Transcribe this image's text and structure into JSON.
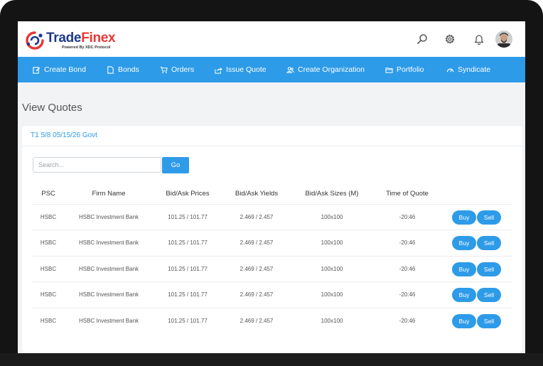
{
  "brand": {
    "name_part1": "Trade",
    "name_part2": "Finex",
    "tagline": "Powered By XDC Protocol"
  },
  "header_icons": [
    "search-icon",
    "gear-icon",
    "bell-icon"
  ],
  "nav": [
    {
      "label": "Create Bond",
      "icon": "edit-icon"
    },
    {
      "label": "Bonds",
      "icon": "document-icon"
    },
    {
      "label": "Orders",
      "icon": "cart-icon"
    },
    {
      "label": "Issue Quote",
      "icon": "share-icon"
    },
    {
      "label": "Create Organization",
      "icon": "users-icon"
    },
    {
      "label": "Portfolio",
      "icon": "folder-icon"
    },
    {
      "label": "Syndicate",
      "icon": "gauge-icon"
    }
  ],
  "page": {
    "title": "View Quotes"
  },
  "card": {
    "title": "T1 5/8 05/15/26 Govt"
  },
  "search": {
    "placeholder": "Search...",
    "value": "",
    "button": "Go"
  },
  "table": {
    "headers": [
      "PSC",
      "Firm Name",
      "Bid/Ask Prices",
      "Bid/Ask Yields",
      "Bid/Ask Sizes (M)",
      "Time of Quote"
    ],
    "rows": [
      {
        "psc": "HSBC",
        "firm": "HSBC Investment Bank",
        "prices": "101.25 / 101.77",
        "yields": "2.469 / 2.457",
        "sizes": "100x100",
        "time": "-20:46",
        "buy": "Buy",
        "sell": "Sell"
      },
      {
        "psc": "HSBC",
        "firm": "HSBC Investment Bank",
        "prices": "101.25 / 101.77",
        "yields": "2.469 / 2.457",
        "sizes": "100x100",
        "time": "-20:46",
        "buy": "Buy",
        "sell": "Sell"
      },
      {
        "psc": "HSBC",
        "firm": "HSBC Investment Bank",
        "prices": "101.25 / 101.77",
        "yields": "2.469 / 2.457",
        "sizes": "100x100",
        "time": "-20:46",
        "buy": "Buy",
        "sell": "Sell"
      },
      {
        "psc": "HSBC",
        "firm": "HSBC Investment Bank",
        "prices": "101.25 / 101.77",
        "yields": "2.469 / 2.457",
        "sizes": "100x100",
        "time": "-20:46",
        "buy": "Buy",
        "sell": "Sell"
      },
      {
        "psc": "HSBC",
        "firm": "HSBC Investment Bank",
        "prices": "101.25 / 101.77",
        "yields": "2.469 / 2.457",
        "sizes": "100x100",
        "time": "-20:46",
        "buy": "Buy",
        "sell": "Sell"
      }
    ]
  },
  "colors": {
    "accent": "#2d9be8",
    "brand_blue": "#1e3a8a",
    "brand_red": "#e53935",
    "background": "#f2f3f5"
  }
}
